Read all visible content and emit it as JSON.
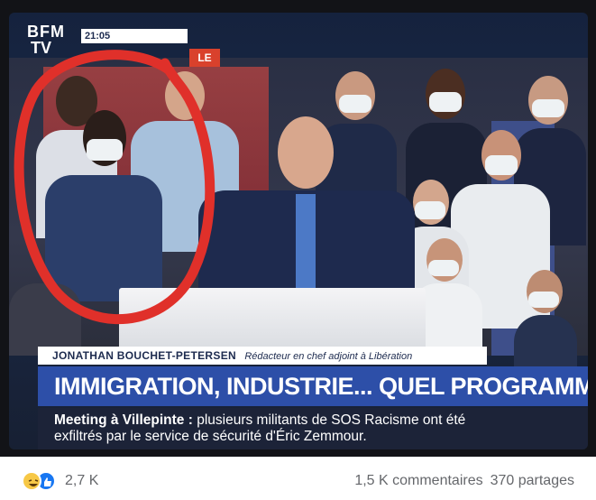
{
  "broadcast": {
    "logo_line1": "BFM",
    "logo_line2": "TV",
    "time_tag": "21:05",
    "live_tag": "LE",
    "lower_third": {
      "name": "JONATHAN BOUCHET-PETERSEN",
      "role": "Rédacteur en chef adjoint à Libération"
    },
    "headline": "IMMIGRATION, INDUSTRIE... QUEL PROGRAMME ?",
    "ticker": {
      "lead": "Meeting à Villepinte :",
      "text": "plusieurs militants de SOS Racisme ont été",
      "line2": "exfiltrés par le service de sécurité d'Éric Zemmour."
    },
    "colors": {
      "headline_bg": "#2d4fa8",
      "ticker_bg": "#1c2338",
      "annotation": "#e0302a"
    }
  },
  "post_footer": {
    "reaction_icons": [
      "haha-icon",
      "like-icon"
    ],
    "reaction_count": "2,7 K",
    "comments": "1,5 K commentaires",
    "shares": "370 partages"
  }
}
